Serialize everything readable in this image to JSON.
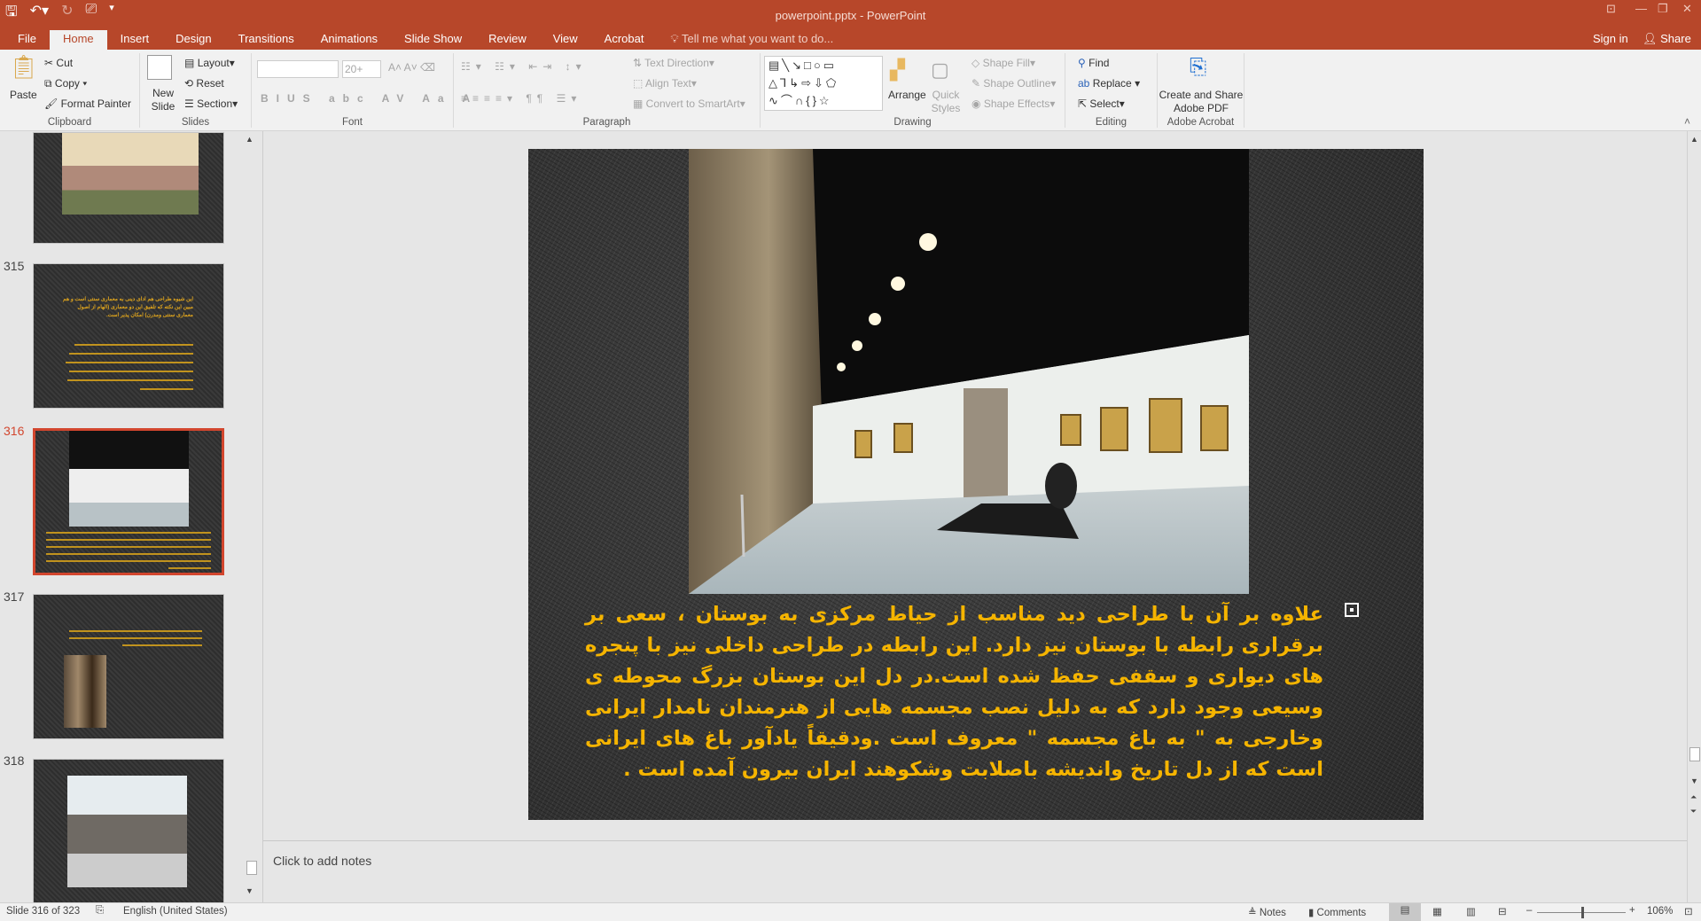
{
  "titlebar": {
    "title": "powerpoint.pptx - PowerPoint",
    "sign_in": "Sign in",
    "share": "Share"
  },
  "tabs": [
    "File",
    "Home",
    "Insert",
    "Design",
    "Transitions",
    "Animations",
    "Slide Show",
    "Review",
    "View",
    "Acrobat"
  ],
  "tell_me": "Tell me what you want to do...",
  "ribbon": {
    "clipboard": {
      "label": "Clipboard",
      "paste": "Paste",
      "cut": "Cut",
      "copy": "Copy",
      "format_painter": "Format Painter"
    },
    "slides": {
      "label": "Slides",
      "new_slide": "New Slide",
      "layout": "Layout",
      "reset": "Reset",
      "section": "Section"
    },
    "font": {
      "label": "Font",
      "font_name": "",
      "font_size": "20+"
    },
    "paragraph": {
      "label": "Paragraph",
      "text_direction": "Text Direction",
      "align_text": "Align Text",
      "convert": "Convert to SmartArt"
    },
    "drawing": {
      "label": "Drawing",
      "arrange": "Arrange",
      "quick_styles": "Quick Styles",
      "shape_fill": "Shape Fill",
      "shape_outline": "Shape Outline",
      "shape_effects": "Shape Effects"
    },
    "editing": {
      "label": "Editing",
      "find": "Find",
      "replace": "Replace",
      "select": "Select"
    },
    "acrobat": {
      "label": "Adobe Acrobat",
      "create": "Create and Share Adobe PDF"
    }
  },
  "thumbnails": [
    {
      "number": "",
      "type": "image"
    },
    {
      "number": "315",
      "type": "text",
      "text": "این شیوه طراحی هم ادای دینی به معماری سنتی است و هم مبین این نکته که تلفیق این دو معماری (الهام از اصول معماری سنتی ومدرن) امکان پذیر است."
    },
    {
      "number": "316",
      "type": "image-text",
      "selected": true
    },
    {
      "number": "317",
      "type": "text-image"
    },
    {
      "number": "318",
      "type": "image"
    }
  ],
  "slide": {
    "body": "علاوه بر آن با طراحی دید مناسب از حیاط مرکزی به بوستان ، سعی بر برقراری رابطه با بوستان نیز دارد. این رابطه در طراحی داخلی نیز با پنجره های دیواری و سقفی حفظ شده است.در دل این بوستان بزرگ محوطه ی وسیعی وجود دارد که به دلیل نصب مجسمه هایی از هنرمندان نامدار ایرانی وخارجی به \" به باغ مجسمه \" معروف است .ودقیقاً یادآور باغ های ایرانی است که از دل  تاریخ واندیشه باصلابت وشکوهند ایران بیرون آمده است .",
    "text_color": "#f5b400"
  },
  "notes": {
    "placeholder": "Click to add notes"
  },
  "status": {
    "slide": "Slide 316 of 323",
    "language": "English (United States)",
    "notes": "Notes",
    "comments": "Comments",
    "zoom": "106%",
    "zoom_percent": 106
  },
  "colors": {
    "accent": "#b7472a",
    "selected": "#d2462e"
  }
}
